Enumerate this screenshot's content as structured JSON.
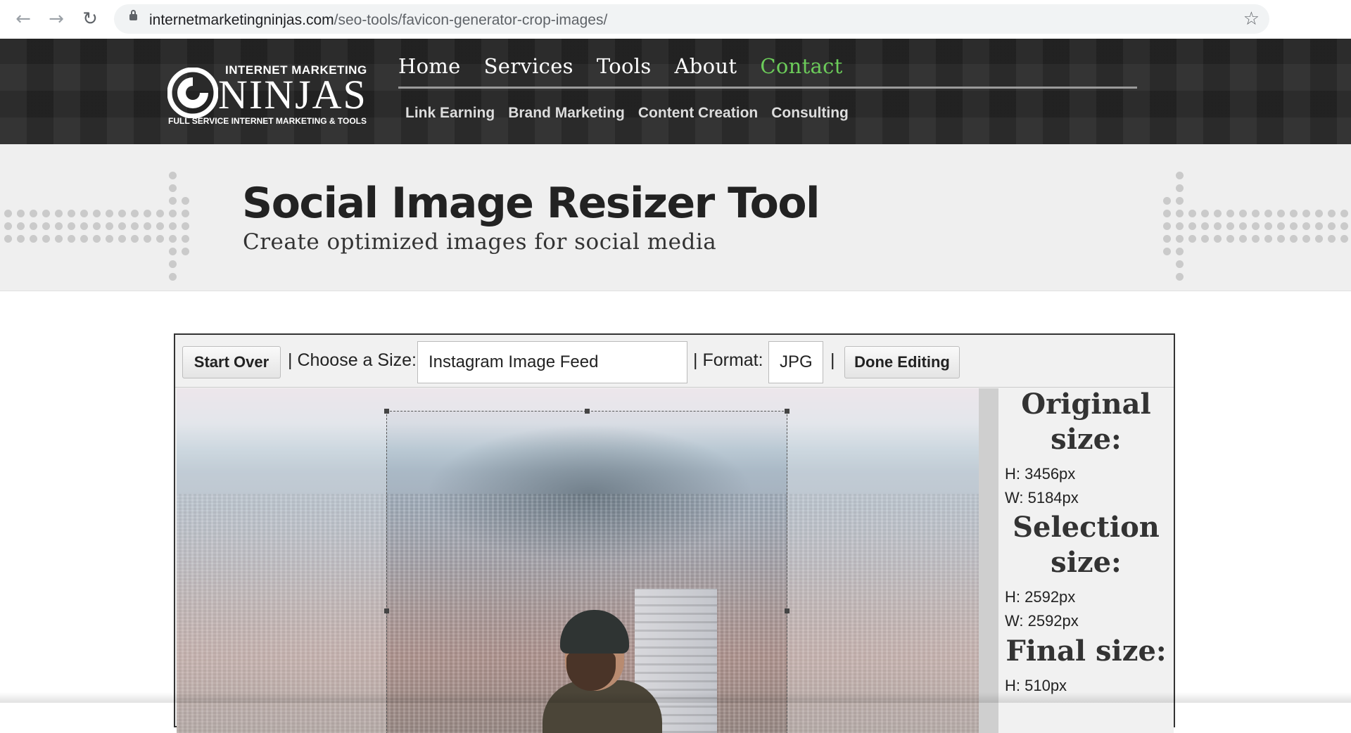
{
  "browser": {
    "url_host": "internetmarketingninjas.com",
    "url_path": "/seo-tools/favicon-generator-crop-images/",
    "back_icon": "←",
    "forward_icon": "→",
    "reload_icon": "↻",
    "bookmark_icon": "☆"
  },
  "logo": {
    "top": "INTERNET MARKETING",
    "big": "NINJAS",
    "sub": "FULL SERVICE INTERNET MARKETING & TOOLS"
  },
  "main_nav": [
    "Home",
    "Services",
    "Tools",
    "About",
    "Contact"
  ],
  "main_nav_active": "Contact",
  "sub_nav": [
    "Link Earning",
    "Brand Marketing",
    "Content Creation",
    "Consulting"
  ],
  "hero": {
    "title": "Social Image Resizer Tool",
    "subtitle": "Create optimized images for social media"
  },
  "toolbar": {
    "start_over": "Start Over",
    "choose_size_label": "| Choose a Size:",
    "size_value": "Instagram Image Feed",
    "format_label": "| Format:",
    "format_value": "JPG",
    "divider": "|",
    "done_editing": "Done Editing"
  },
  "info": {
    "original_heading": "Original size:",
    "original_h": "H: 3456px",
    "original_w": "W: 5184px",
    "selection_heading": "Selection size:",
    "selection_h": "H: 2592px",
    "selection_w": "W: 2592px",
    "final_heading": "Final size:",
    "final_h": "H: 510px"
  },
  "colors": {
    "header_bg": "#262626",
    "nav_active": "#6ccc5a",
    "hero_bg": "#efefef"
  }
}
